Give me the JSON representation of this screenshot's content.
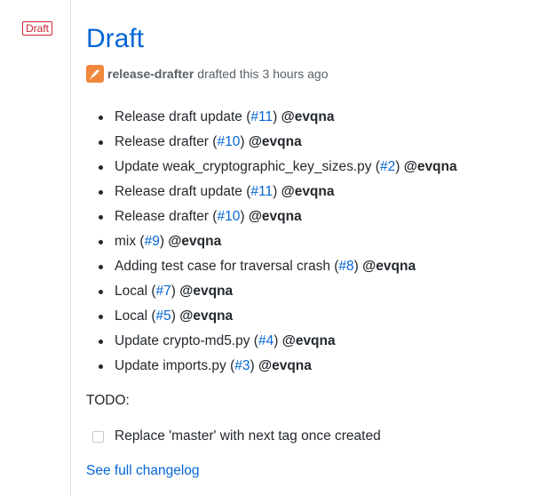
{
  "badge": {
    "label": "Draft"
  },
  "release": {
    "title": "Draft",
    "author": "release-drafter",
    "action": "drafted this",
    "time": "3 hours ago"
  },
  "changes": [
    {
      "text": "Release draft update (",
      "pr": "#11",
      "close": ")",
      "user": "@evqna"
    },
    {
      "text": "Release drafter (",
      "pr": "#10",
      "close": ")",
      "user": "@evqna"
    },
    {
      "text": "Update weak_cryptographic_key_sizes.py (",
      "pr": "#2",
      "close": ")",
      "user": "@evqna"
    },
    {
      "text": "Release draft update (",
      "pr": "#11",
      "close": ")",
      "user": "@evqna"
    },
    {
      "text": "Release drafter (",
      "pr": "#10",
      "close": ")",
      "user": "@evqna"
    },
    {
      "text": "mix (",
      "pr": "#9",
      "close": ")",
      "user": "@evqna"
    },
    {
      "text": "Adding test case for traversal crash (",
      "pr": "#8",
      "close": ")",
      "user": "@evqna"
    },
    {
      "text": "Local (",
      "pr": "#7",
      "close": ")",
      "user": "@evqna"
    },
    {
      "text": "Local (",
      "pr": "#5",
      "close": ")",
      "user": "@evqna"
    },
    {
      "text": "Update crypto-md5.py (",
      "pr": "#4",
      "close": ")",
      "user": "@evqna"
    },
    {
      "text": "Update imports.py (",
      "pr": "#3",
      "close": ")",
      "user": "@evqna"
    }
  ],
  "todo": {
    "label": "TODO:",
    "task": "Replace 'master' with next tag once created",
    "checked": false
  },
  "changelog_link": "See full changelog",
  "colors": {
    "link": "#0366d6",
    "badge": "#cb2431",
    "avatar": "#f0883e"
  }
}
